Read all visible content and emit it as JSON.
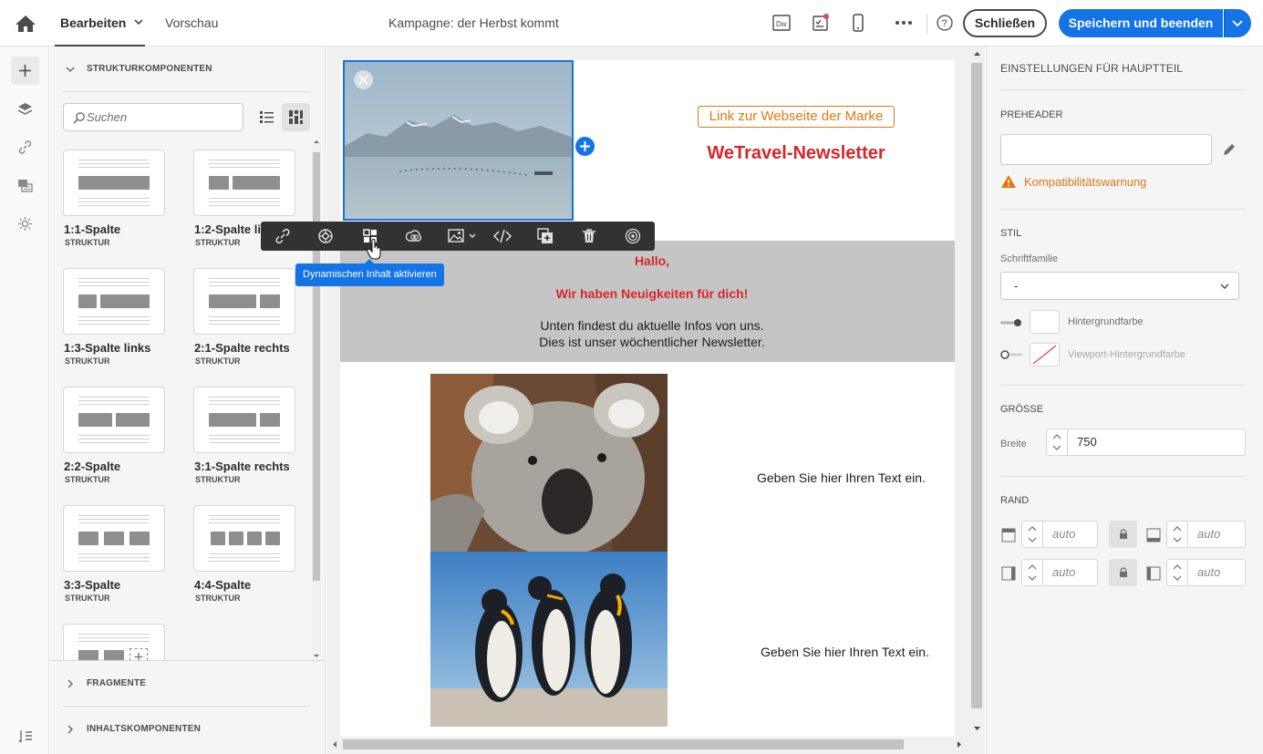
{
  "topbar": {
    "tab_edit": "Bearbeiten",
    "tab_preview": "Vorschau",
    "title": "Kampagne: der Herbst kommt",
    "close_label": "Schließen",
    "save_label": "Speichern und beenden",
    "accent": "#1473e6"
  },
  "left_rail": {
    "icons": [
      "plus-icon",
      "layers-icon",
      "link-icon",
      "personalization-icon",
      "dynamic-content-icon",
      "settings-icon"
    ]
  },
  "panel": {
    "section_structure": "STRUKTURKOMPONENTEN",
    "search_placeholder": "Suchen",
    "structures": [
      {
        "name": "1:1-Spalte",
        "kind": "STRUKTUR"
      },
      {
        "name": "1:2-Spalte links",
        "kind": "STRUKTUR"
      },
      {
        "name": "1:3-Spalte links",
        "kind": "STRUKTUR"
      },
      {
        "name": "2:1-Spalte rechts",
        "kind": "STRUKTUR"
      },
      {
        "name": "2:2-Spalte",
        "kind": "STRUKTUR"
      },
      {
        "name": "3:1-Spalte rechts",
        "kind": "STRUKTUR"
      },
      {
        "name": "3:3-Spalte",
        "kind": "STRUKTUR"
      },
      {
        "name": "4:4-Spalte",
        "kind": "STRUKTUR"
      }
    ],
    "section_fragments": "FRAGMENTE",
    "section_content": "INHALTSKOMPONENTEN"
  },
  "email": {
    "brand_link": "Link zur Webseite der Marke",
    "newsletter_title": "WeTravel-Newsletter",
    "hallo": "Hallo,",
    "news": "Wir haben Neuigkeiten für dich!",
    "sub1": "Unten findest du aktuelle Infos von uns.",
    "sub2": "Dies ist unser wöchentlicher Newsletter.",
    "text_koala": "Geben Sie hier Ihren Text ein.",
    "text_penguin": "Geben Sie hier Ihren Text ein.",
    "title_color": "#d7262b",
    "link_color": "#e0780f"
  },
  "toolbar": {
    "tooltip": "Dynamischen Inhalt aktivieren",
    "tools": [
      "link-icon",
      "personalization-icon",
      "dynamic-content-icon",
      "creative-cloud-icon",
      "image-icon",
      "code-icon",
      "duplicate-icon",
      "delete-icon",
      "target-icon"
    ]
  },
  "settings": {
    "title": "EINSTELLUNGEN FÜR HAUPTTEIL",
    "preheader_label": "PREHEADER",
    "preheader_value": "",
    "warning": "Kompatibilitätswarnung",
    "style_label": "STIL",
    "font_family_label": "Schriftfamilie",
    "font_family_value": "-",
    "bg_color_label": "Hintergrundfarbe",
    "viewport_bg_label": "Viewport-Hintergrundfarbe",
    "size_label": "GRÖSSE",
    "width_label": "Breite",
    "width_value": "750",
    "margin_label": "RAND",
    "margin_placeholder": "auto"
  }
}
